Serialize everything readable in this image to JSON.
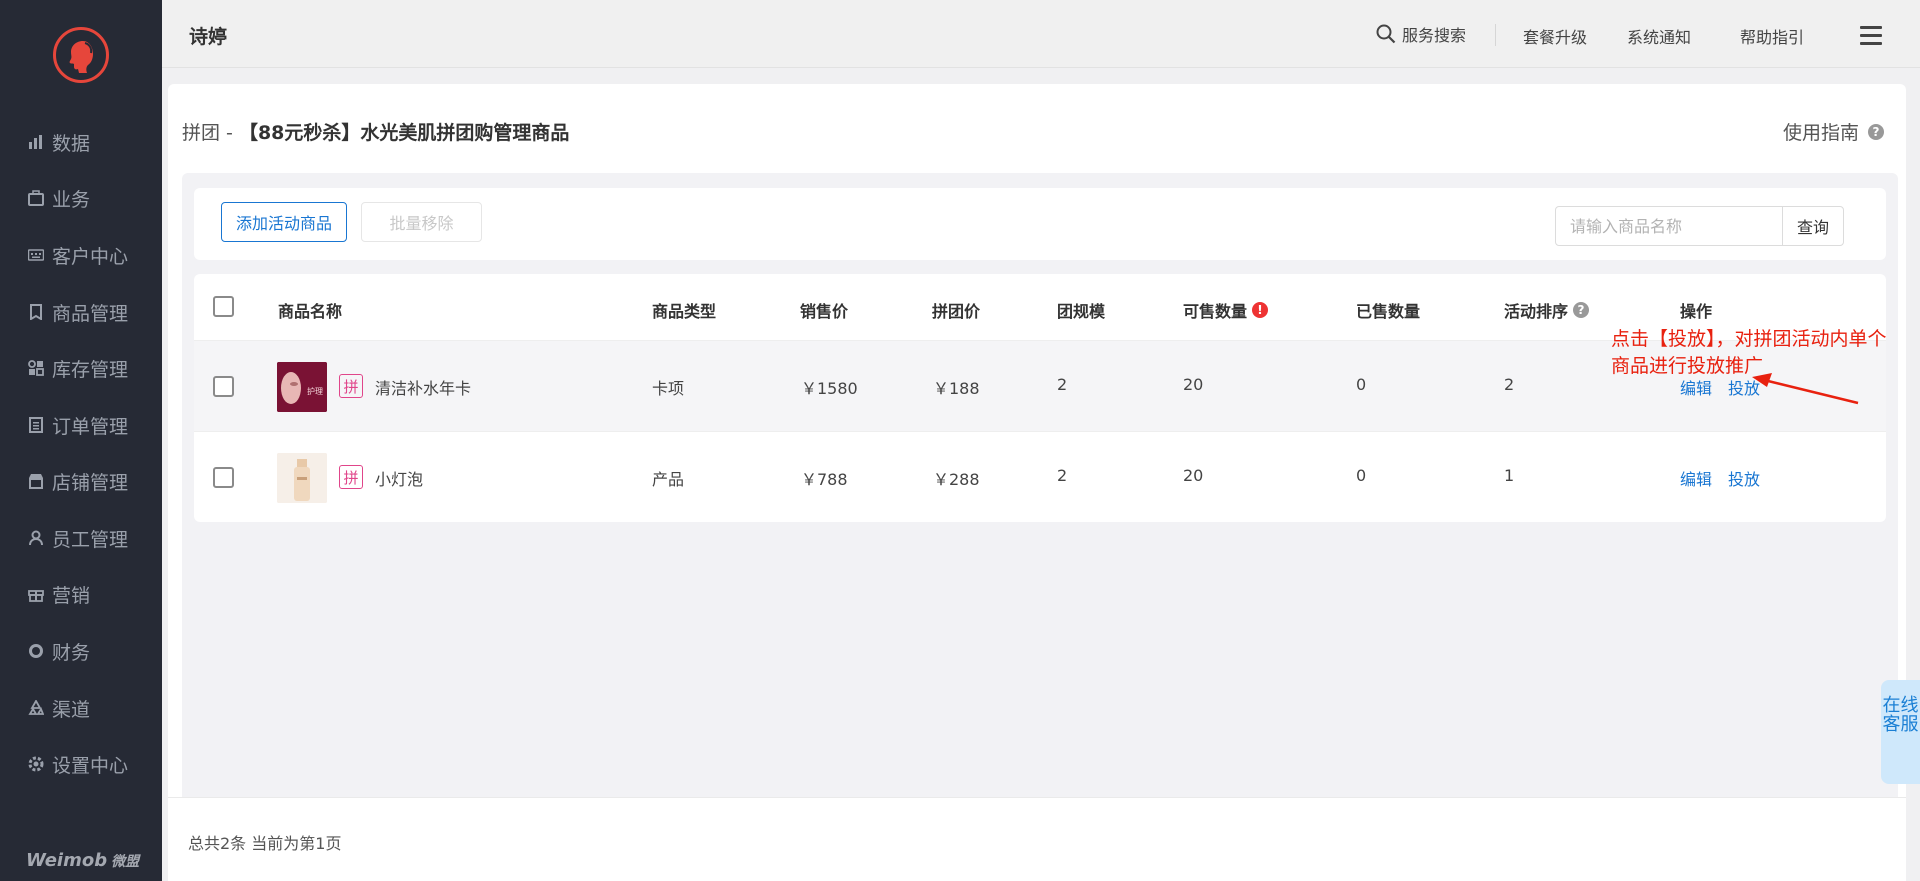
{
  "app": {
    "title": "诗婷"
  },
  "sidebar": {
    "items": [
      {
        "label": "数据",
        "icon": "bar-chart-icon"
      },
      {
        "label": "业务",
        "icon": "briefcase-icon"
      },
      {
        "label": "客户中心",
        "icon": "keyboard-icon"
      },
      {
        "label": "商品管理",
        "icon": "bookmark-icon"
      },
      {
        "label": "库存管理",
        "icon": "grid-icon"
      },
      {
        "label": "订单管理",
        "icon": "list-icon"
      },
      {
        "label": "店铺管理",
        "icon": "store-icon"
      },
      {
        "label": "员工管理",
        "icon": "person-icon"
      },
      {
        "label": "营销",
        "icon": "gift-icon"
      },
      {
        "label": "财务",
        "icon": "coin-icon"
      },
      {
        "label": "渠道",
        "icon": "recycle-icon"
      },
      {
        "label": "设置中心",
        "icon": "gear-icon"
      }
    ],
    "brand": "Weimob",
    "brand_cn": "微盟"
  },
  "topbar": {
    "search_label": "服务搜索",
    "upgrade_label": "套餐升级",
    "notify_label": "系统通知",
    "help_label": "帮助指引"
  },
  "page": {
    "breadcrumb_prefix": "拼团 - ",
    "breadcrumb_title": "【88元秒杀】水光美肌拼团购管理商品",
    "guide_label": "使用指南"
  },
  "toolbar": {
    "add_label": "添加活动商品",
    "remove_label": "批量移除",
    "search_placeholder": "请输入商品名称",
    "query_label": "查询"
  },
  "table": {
    "headers": {
      "name": "商品名称",
      "type": "商品类型",
      "price": "销售价",
      "group_price": "拼团价",
      "group_size": "团规模",
      "available": "可售数量",
      "sold": "已售数量",
      "rank": "活动排序",
      "ops": "操作"
    },
    "rows": [
      {
        "tag": "拼",
        "name": "清洁补水年卡",
        "type": "卡项",
        "price": "￥1580",
        "group_price": "￥188",
        "group_size": "2",
        "available": "20",
        "sold": "0",
        "rank": "2",
        "edit_label": "编辑",
        "launch_label": "投放"
      },
      {
        "tag": "拼",
        "name": "小灯泡",
        "type": "产品",
        "price": "￥788",
        "group_price": "￥288",
        "group_size": "2",
        "available": "20",
        "sold": "0",
        "rank": "1",
        "edit_label": "编辑",
        "launch_label": "投放"
      }
    ]
  },
  "annotation": {
    "text": "点击【投放】，对拼团活动内单个商品进行投放推广",
    "color": "#e8210f"
  },
  "footer": {
    "summary": "总共2条 当前为第1页"
  },
  "cs_float": {
    "label": "在线客服"
  },
  "colors": {
    "accent": "#1976d2",
    "sidebar_bg": "#262a35",
    "logo": "#e6463b",
    "tag": "#e0458a"
  }
}
